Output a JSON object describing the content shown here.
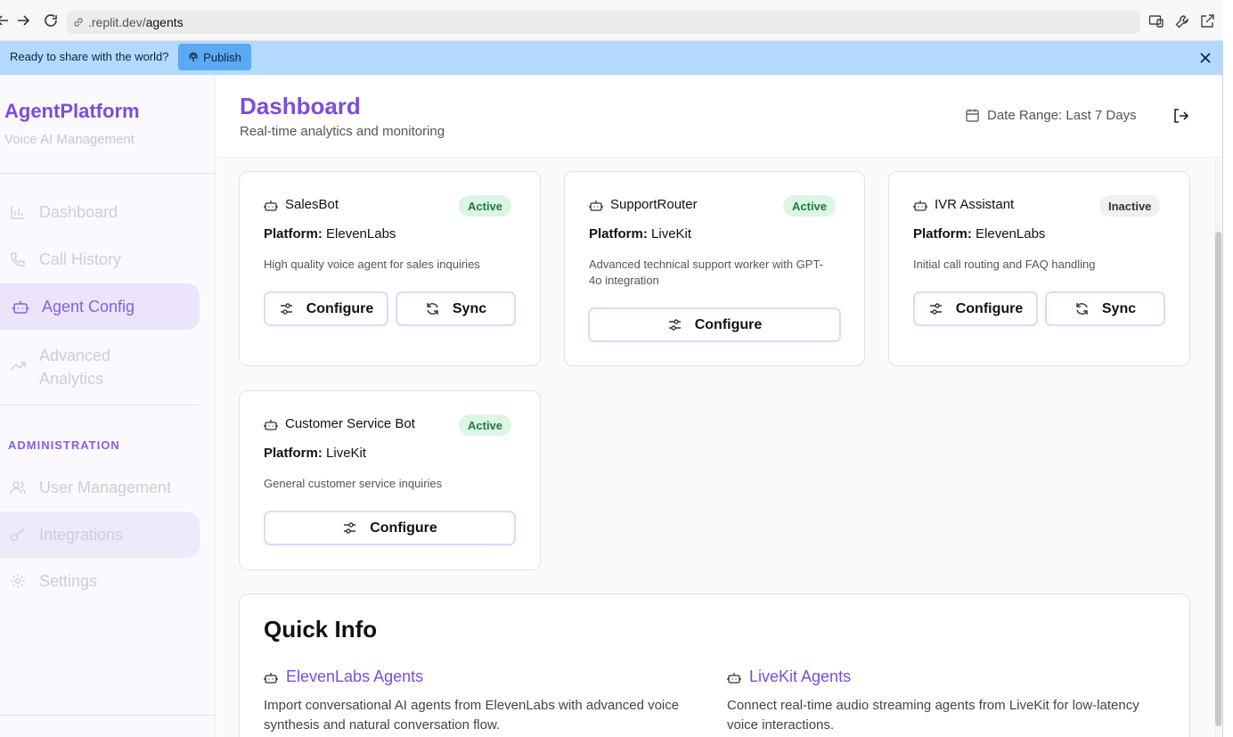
{
  "browser": {
    "url_host": ".replit.dev/",
    "url_path": "agents"
  },
  "banner": {
    "text": "Ready to share with the world?",
    "publish_label": "Publish"
  },
  "sidebar": {
    "brand": "AgentPlatform",
    "brand_sub": "Voice AI Management",
    "items": [
      {
        "label": "Dashboard",
        "icon": "bar-chart-icon"
      },
      {
        "label": "Call History",
        "icon": "phone-icon"
      },
      {
        "label": "Agent Config",
        "icon": "bot-icon"
      },
      {
        "label": "Advanced Analytics",
        "icon": "trending-up-icon"
      }
    ],
    "admin_section": "ADMINISTRATION",
    "admin_items": [
      {
        "label": "User Management",
        "icon": "users-icon"
      },
      {
        "label": "Integrations",
        "icon": "key-icon"
      },
      {
        "label": "Settings",
        "icon": "gear-icon"
      }
    ]
  },
  "header": {
    "title": "Dashboard",
    "subtitle": "Real-time analytics and monitoring",
    "date_range": "Date Range: Last 7 Days"
  },
  "agents": [
    {
      "name": "SalesBot",
      "status": "Active",
      "platform_label": "Platform:",
      "platform": "ElevenLabs",
      "description": "High quality voice agent for sales inquiries",
      "configure": "Configure",
      "sync": "Sync"
    },
    {
      "name": "SupportRouter",
      "status": "Active",
      "platform_label": "Platform:",
      "platform": "LiveKit",
      "description": "Advanced technical support worker with GPT-4o integration",
      "configure": "Configure"
    },
    {
      "name": "IVR Assistant",
      "status": "Inactive",
      "platform_label": "Platform:",
      "platform": "ElevenLabs",
      "description": "Initial call routing and FAQ handling",
      "configure": "Configure",
      "sync": "Sync"
    },
    {
      "name": "Customer Service Bot",
      "status": "Active",
      "platform_label": "Platform:",
      "platform": "LiveKit",
      "description": "General customer service inquiries",
      "configure": "Configure"
    }
  ],
  "quick_info": {
    "title": "Quick Info",
    "elevenlabs": {
      "title": "ElevenLabs Agents",
      "desc": "Import conversational AI agents from ElevenLabs with advanced voice synthesis and natural conversation flow."
    },
    "livekit": {
      "title": "LiveKit Agents",
      "desc": "Connect real-time audio streaming agents from LiveKit for low-latency voice interactions."
    }
  },
  "colors": {
    "accent": "#7c4ddb",
    "banner": "#b3dafe",
    "active_badge": "#dcf5e4"
  }
}
